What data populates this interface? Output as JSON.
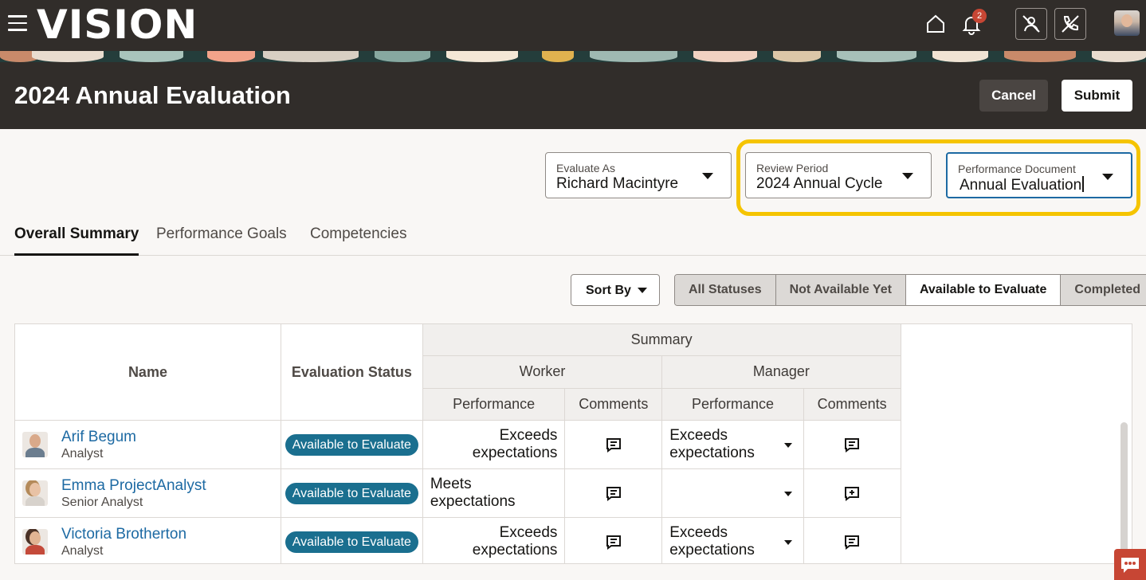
{
  "header": {
    "app_name": "VISION",
    "notification_count": "2",
    "icons": [
      "menu-icon",
      "home-icon",
      "bell-icon",
      "person-off-icon",
      "phone-off-icon",
      "user-avatar"
    ]
  },
  "page": {
    "title": "2024 Annual Evaluation",
    "cancel_label": "Cancel",
    "submit_label": "Submit"
  },
  "selectors": {
    "evaluate_as": {
      "label": "Evaluate As",
      "value": "Richard Macintyre"
    },
    "review_period": {
      "label": "Review Period",
      "value": "2024 Annual Cycle"
    },
    "performance_document": {
      "label": "Performance Document",
      "value": "Annual Evaluation"
    }
  },
  "tabs": [
    {
      "label": "Overall Summary",
      "active": true
    },
    {
      "label": "Performance Goals",
      "active": false
    },
    {
      "label": "Competencies",
      "active": false
    }
  ],
  "toolbar": {
    "sort_label": "Sort By",
    "filters": [
      "All Statuses",
      "Not Available Yet",
      "Available to Evaluate",
      "Completed"
    ],
    "selected_filter": "Available to Evaluate"
  },
  "table": {
    "headers": {
      "name": "Name",
      "status": "Evaluation Status",
      "summary": "Summary",
      "worker": "Worker",
      "manager": "Manager",
      "performance": "Performance",
      "comments": "Comments"
    },
    "rows": [
      {
        "name": "Arif Begum",
        "role": "Analyst",
        "status": "Available to Evaluate",
        "worker_performance": "Exceeds expectations",
        "worker_comment_icon": "comment-icon",
        "manager_performance": "Exceeds expectations",
        "manager_comment_icon": "comment-icon"
      },
      {
        "name": "Emma ProjectAnalyst",
        "role": "Senior Analyst",
        "status": "Available to Evaluate",
        "worker_performance": "Meets expectations",
        "worker_comment_icon": "comment-icon",
        "manager_performance": "",
        "manager_comment_icon": "add-comment-icon"
      },
      {
        "name": "Victoria Brotherton",
        "role": "Analyst",
        "status": "Available to Evaluate",
        "worker_performance": "Exceeds expectations",
        "worker_comment_icon": "comment-icon",
        "manager_performance": "Exceeds expectations",
        "manager_comment_icon": "comment-icon"
      }
    ]
  },
  "colors": {
    "header_bg": "#312d2a",
    "link": "#1d6aa3",
    "status_badge": "#1a6f8f",
    "highlight": "#f5c400",
    "chat_button": "#c74634"
  }
}
